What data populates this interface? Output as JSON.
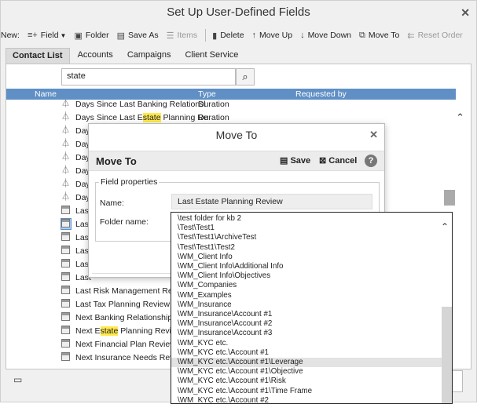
{
  "window": {
    "title": "Set Up User-Defined Fields"
  },
  "toolbar": {
    "new_label": "New:",
    "field": "Field",
    "folder": "Folder",
    "save_as": "Save As",
    "items": "Items",
    "delete": "Delete",
    "move_up": "Move Up",
    "move_down": "Move Down",
    "move_to": "Move To",
    "reset_order": "Reset Order"
  },
  "tabs": [
    "Contact List",
    "Accounts",
    "Campaigns",
    "Client Service"
  ],
  "search": {
    "value": "state"
  },
  "grid": {
    "columns": [
      "Name",
      "Type",
      "Requested by"
    ],
    "rows": [
      {
        "pre": "Days Since Last Banking Relationsl",
        "hl": "",
        "post": "",
        "type": "Duration",
        "icon": "beaker"
      },
      {
        "pre": "Days Since Last E",
        "hl": "state",
        "post": " Planning Re",
        "type": "Duration",
        "icon": "beaker"
      },
      {
        "pre": "Day",
        "hl": "",
        "post": "",
        "type": "",
        "icon": "beaker"
      },
      {
        "pre": "Day",
        "hl": "",
        "post": "",
        "type": "",
        "icon": "beaker"
      },
      {
        "pre": "Day",
        "hl": "",
        "post": "",
        "type": "",
        "icon": "beaker"
      },
      {
        "pre": "Day",
        "hl": "",
        "post": "",
        "type": "",
        "icon": "beaker"
      },
      {
        "pre": "Day",
        "hl": "",
        "post": "",
        "type": "",
        "icon": "beaker"
      },
      {
        "pre": "Day",
        "hl": "",
        "post": "",
        "type": "",
        "icon": "beaker"
      },
      {
        "pre": "Last",
        "hl": "",
        "post": "",
        "type": "",
        "icon": "calendar"
      },
      {
        "pre": "Last",
        "hl": "",
        "post": "",
        "type": "",
        "icon": "calendar",
        "selected": true
      },
      {
        "pre": "Last",
        "hl": "",
        "post": "",
        "type": "",
        "icon": "calendar"
      },
      {
        "pre": "Last",
        "hl": "",
        "post": "",
        "type": "",
        "icon": "calendar"
      },
      {
        "pre": "Last",
        "hl": "",
        "post": "",
        "type": "",
        "icon": "calendar"
      },
      {
        "pre": "Last",
        "hl": "",
        "post": "",
        "type": "",
        "icon": "calendar"
      },
      {
        "pre": "Last Risk Management Revi",
        "hl": "",
        "post": "",
        "type": "",
        "icon": "calendar"
      },
      {
        "pre": "Last Tax Planning Review",
        "hl": "",
        "post": "",
        "type": "",
        "icon": "calendar"
      },
      {
        "pre": "Next Banking Relationship I",
        "hl": "",
        "post": "",
        "type": "",
        "icon": "calendar"
      },
      {
        "pre": "Next E",
        "hl": "state",
        "post": " Planning Review",
        "type": "",
        "icon": "calendar"
      },
      {
        "pre": "Next Financial Plan Review",
        "hl": "",
        "post": "",
        "type": "",
        "icon": "calendar"
      },
      {
        "pre": "Next Insurance Needs Revi",
        "hl": "",
        "post": "",
        "type": "",
        "icon": "calendar"
      }
    ]
  },
  "dialog": {
    "title": "Move To",
    "heading": "Move To",
    "save": "Save",
    "cancel": "Cancel",
    "help": "?",
    "fieldset_legend": "Field properties",
    "name_label": "Name:",
    "name_value": "Last Estate Planning Review",
    "folder_label": "Folder name:"
  },
  "folder_options": [
    "\\test folder for kb 2",
    "\\Test\\Test1",
    "\\Test\\Test1\\ArchiveTest",
    "\\Test\\Test1\\Test2",
    "\\WM_Client Info",
    "\\WM_Client Info\\Additional Info",
    "\\WM_Client Info\\Objectives",
    "\\WM_Companies",
    "\\WM_Examples",
    "\\WM_Insurance",
    "\\WM_Insurance\\Account #1",
    "\\WM_Insurance\\Account #2",
    "\\WM_Insurance\\Account #3",
    "\\WM_KYC etc.",
    "\\WM_KYC etc.\\Account #1",
    "\\WM_KYC etc.\\Account #1\\Leverage",
    "\\WM_KYC etc.\\Account #1\\Objective",
    "\\WM_KYC etc.\\Account #1\\Risk",
    "\\WM_KYC etc.\\Account #1\\Time Frame",
    "\\WM_KYC etc.\\Account #2"
  ],
  "folder_hover_index": 15,
  "icons": {
    "close": "close-icon",
    "field": "field-list-icon",
    "folder": "folder-icon",
    "save": "save-icon",
    "search": "search-icon",
    "beaker": "beaker-icon",
    "calendar": "calendar-icon"
  },
  "colors": {
    "header_blue": "#5f8fc5",
    "highlight": "#ffe94d",
    "selected": "#a9cdf2"
  }
}
